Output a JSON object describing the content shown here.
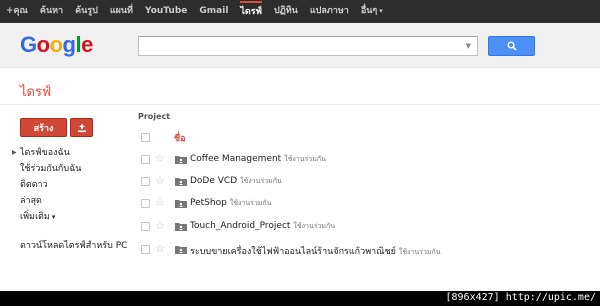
{
  "topnav": {
    "items": [
      "+คุณ",
      "ค้นหา",
      "ค้นรูป",
      "แผนที่",
      "YouTube",
      "Gmail",
      "ไดรฟ์",
      "ปฏิทิน",
      "แปลภาษา",
      "อื่นๆ"
    ],
    "active_index": 6
  },
  "header": {
    "logo": [
      "G",
      "o",
      "o",
      "g",
      "l",
      "e"
    ],
    "logo_colors": [
      "#3369e8",
      "#d50f25",
      "#eeb211",
      "#3369e8",
      "#009925",
      "#d50f25"
    ],
    "search_value": ""
  },
  "app": {
    "title": "ไดรฟ์",
    "create_label": "สร้าง",
    "accent_color": "#dd4b39"
  },
  "sidebar": {
    "items": [
      "ไดรฟ์ของฉัน",
      "ใช้ร่วมกันกับฉัน",
      "ติดดาว",
      "ล่าสุด",
      "เพิ่มเติม",
      "ดาวน์โหลดไดรฟ์สำหรับ PC"
    ]
  },
  "list": {
    "column_title": "Project",
    "sort_title": "ชื่อ",
    "rows": [
      {
        "name": "Coffee Management",
        "shared": "ใช้งานร่วมกัน"
      },
      {
        "name": "DoDe VCD",
        "shared": "ใช้งานร่วมกัน"
      },
      {
        "name": "PetShop",
        "shared": "ใช้งานร่วมกัน"
      },
      {
        "name": "Touch_Android_Project",
        "shared": "ใช้งานร่วมกัน"
      },
      {
        "name": "ระบบขายเครื่องใช้ไฟฟ้าออนไลน์ร้านจักรแก้วพาณิชย์",
        "shared": "ใช้งานร่วมกัน"
      }
    ]
  },
  "watermark": "[896x427] http://upic.me/"
}
